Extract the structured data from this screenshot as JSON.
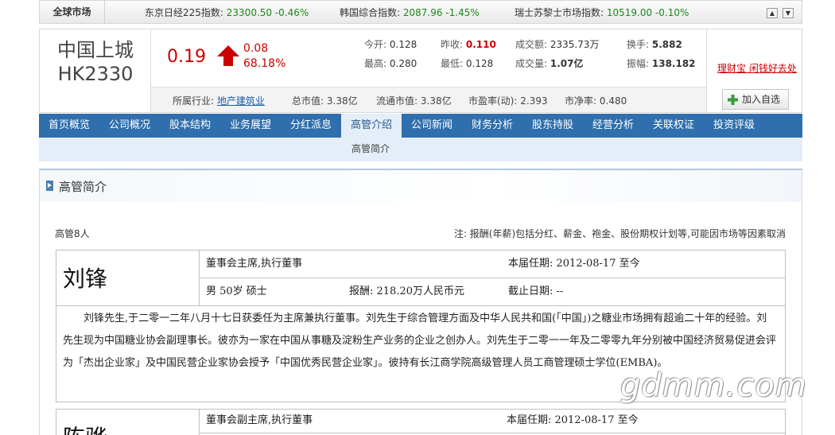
{
  "ticker": {
    "market_label": "全球市场",
    "indices": [
      {
        "name": "东京日经225指数:",
        "value": "23300.50 -0.46%"
      },
      {
        "name": "韩国综合指数:",
        "value": "2087.96 -1.45%"
      },
      {
        "name": "瑞士苏黎士市场指数:",
        "value": "10519.00 -0.10%"
      }
    ],
    "up_icon": "triangle-up-icon",
    "down_icon": "triangle-down-icon"
  },
  "stock": {
    "name": "中国上城",
    "code": "HK2330",
    "price": "0.19",
    "change": "0.08",
    "change_pct": "68.18%",
    "colors": {
      "up": "#cc0000",
      "down": "#1a8a1a",
      "link": "#1a5fa8"
    },
    "stats": {
      "open_label": "今开:",
      "open": "0.128",
      "prev_label": "昨收:",
      "prev": "0.110",
      "amount_label": "成交额:",
      "amount": "2335.73万",
      "turnover_label": "换手:",
      "turnover": "5.882",
      "high_label": "最高:",
      "high": "0.280",
      "low_label": "最低:",
      "low": "0.128",
      "volume_label": "成交量:",
      "volume": "1.07亿",
      "amplitude_label": "振幅:",
      "amplitude": "138.182"
    },
    "promo": "理财宝 闲钱好去处",
    "info": {
      "industry_label": "所属行业:",
      "industry": "地产建筑业",
      "mcap_label": "总市值:",
      "mcap": "3.38亿",
      "float_label": "流通市值:",
      "float": "3.38亿",
      "pe_label": "市盈率(动):",
      "pe": "2.393",
      "pb_label": "市净率:",
      "pb": "0.480"
    },
    "add_button": "加入自选"
  },
  "nav": {
    "tabs": [
      "首页概览",
      "公司概况",
      "股本结构",
      "业务展望",
      "分红派息",
      "高管介绍",
      "公司新闻",
      "财务分析",
      "股东持股",
      "经营分析",
      "关联权证",
      "投资评级"
    ],
    "active": "高管介绍",
    "sub": "高管简介"
  },
  "section": {
    "title": "高管简介",
    "count": "高管8人",
    "note": "注: 报酬(年薪)包括分红、薪金、袍金、股份期权计划等,可能因市场等因素取消"
  },
  "executives": [
    {
      "name": "刘锋",
      "position": "董事会主席,执行董事",
      "term": "本届任期: 2012-08-17 至今",
      "profile": "男  50岁  硕士",
      "salary": "报酬: 218.20万人民币元",
      "deadline": "截止日期: --",
      "bio": "刘锋先生,于二零一二年八月十七日获委任为主席兼执行董事。刘先生于综合管理方面及中华人民共和国(「中国」)之糖业市场拥有超逾二十年的经验。刘先生现为中国糖业协会副理事长。彼亦为一家在中国从事糖及淀粉生产业务的企业之创办人。刘先生于二零一一年及二零零九年分别被中国经济贸易促进会评为「杰出企业家」及中国民营企业家协会授予「中国优秀民营企业家」。彼持有长江商学院高级管理人员工商管理硕士学位(EMBA)。"
    },
    {
      "name": "陈骅",
      "position": "董事会副主席,执行董事",
      "term": "本届任期: 2012-08-17 至今"
    }
  ],
  "watermark": "gdmm.com"
}
